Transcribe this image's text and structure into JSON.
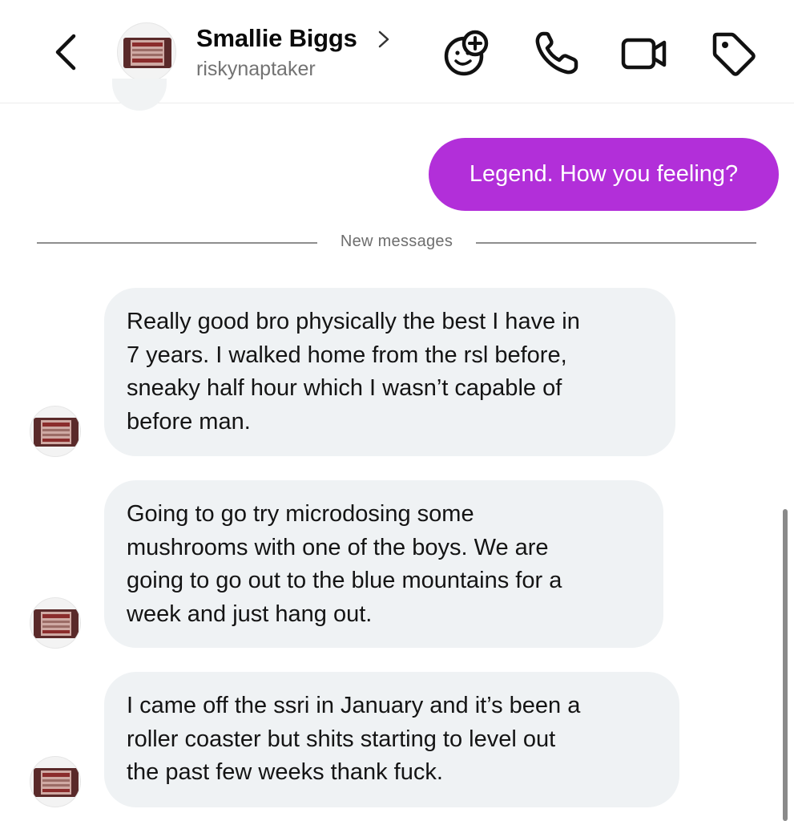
{
  "header": {
    "name": "Smallie Biggs",
    "username": "riskynaptaker",
    "icons": [
      "back-chevron-icon",
      "chevron-right-icon",
      "add-emoji-icon",
      "phone-icon",
      "video-camera-icon",
      "tag-icon"
    ]
  },
  "messages": {
    "sent": [
      {
        "text": "Legend. How you feeling?"
      }
    ],
    "divider_label": "New messages",
    "received": [
      {
        "lines": [
          "Really good bro physically the best I have in",
          "7 years. I walked home from the rsl before,",
          "sneaky half hour which I wasn’t capable of",
          "before man."
        ]
      },
      {
        "lines": [
          "Going to go try microdosing some",
          "mushrooms with one of the boys. We are",
          "going to go out to the blue mountains for a",
          "week and just hang out."
        ]
      },
      {
        "lines": [
          "I came off the ssri in January and it’s been a",
          "roller coaster but shits starting to level out",
          "the past few weeks thank fuck."
        ]
      }
    ]
  },
  "colors": {
    "sent_bubble": "#b22fd9",
    "received_bubble": "#eff2f4",
    "muted_text": "#737373"
  }
}
